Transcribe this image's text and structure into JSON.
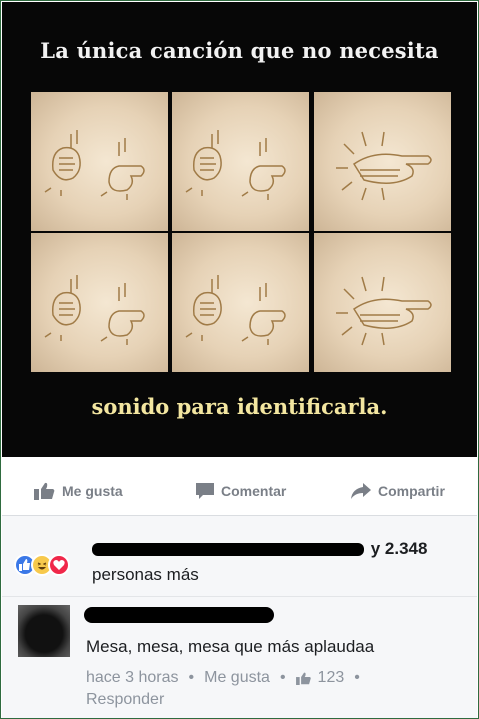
{
  "meme": {
    "title": "La única canción que no necesita",
    "caption": "sonido para identificarla."
  },
  "actions": {
    "like": "Me gusta",
    "comment": "Comentar",
    "share": "Compartir"
  },
  "reactions": {
    "icons": [
      "like-icon",
      "haha-icon",
      "love-icon"
    ],
    "count_text": "y 2.348",
    "suffix": "personas más"
  },
  "comment": {
    "text": "Mesa, mesa, mesa que más aplaudaa",
    "time": "hace 3 horas",
    "like": "Me gusta",
    "likes_count": "123",
    "reply": "Responder"
  }
}
